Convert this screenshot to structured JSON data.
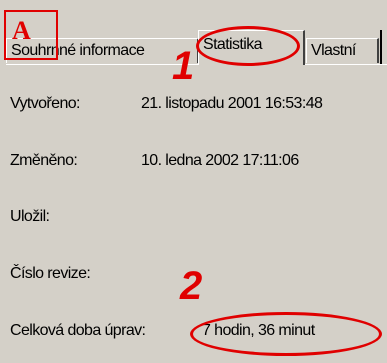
{
  "tabs": [
    {
      "label": "Souhrnné informace"
    },
    {
      "label": "Statistika"
    },
    {
      "label": "Vlastní"
    }
  ],
  "stats": {
    "created_label": "Vytvořeno:",
    "created_value": "21. listopadu 2001  16:53:48",
    "modified_label": "Změněno:",
    "modified_value": "10. ledna 2002  17:11:06",
    "saved_by_label": "Uložil:",
    "revision_label": "Číslo revize:",
    "edit_time_label": "Celková doba úprav:",
    "edit_time_value": "7 hodin, 36 minut"
  },
  "annotations": {
    "marker_a": "A",
    "marker_1": "1",
    "marker_2": "2",
    "color": "#e00000"
  }
}
